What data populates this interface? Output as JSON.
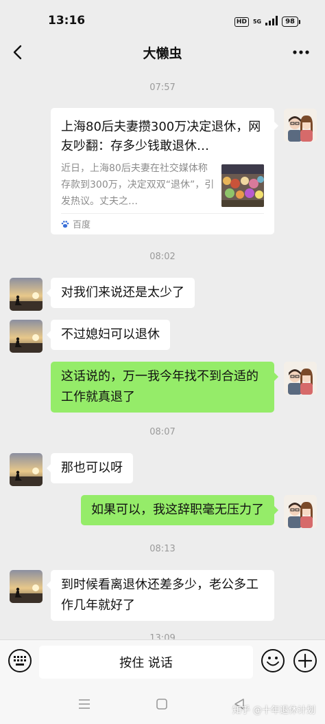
{
  "status_bar": {
    "time": "13:16",
    "hd_label": "HD",
    "network_label": "5G",
    "battery": "98"
  },
  "header": {
    "title": "大懒虫"
  },
  "timestamps": [
    "07:57",
    "08:02",
    "08:07",
    "08:13",
    "13:09"
  ],
  "link_card": {
    "title": "上海80后夫妻攒300万决定退休，网友吵翻：存多少钱敢退休…",
    "description": "近日，上海80后夫妻在社交媒体称存款到300万，决定双双“退休”，引发热议。丈夫之…",
    "source": "百度"
  },
  "messages": [
    {
      "from": "other",
      "text": "对我们来说还是太少了"
    },
    {
      "from": "other",
      "text": "不过媳妇可以退休"
    },
    {
      "from": "me",
      "text": "这话说的，万一我今年找不到合适的工作就真退了"
    },
    {
      "from": "other",
      "text": "那也可以呀"
    },
    {
      "from": "me",
      "text": "如果可以，我这辞职毫无压力了"
    },
    {
      "from": "other",
      "text": "到时候看离退休还差多少，老公多工作几年就好了"
    }
  ],
  "input_bar": {
    "hold_to_talk_label": "按住 说话"
  },
  "watermark": {
    "text": "知乎 @十年退休计划"
  },
  "icons": {
    "back": "chevron-left-icon",
    "more": "more-dots-icon",
    "keyboard": "keyboard-icon",
    "emoji": "emoji-icon",
    "plus": "plus-icon",
    "source": "baidu-paw-icon"
  },
  "colors": {
    "background": "#ededed",
    "incoming_bubble": "#ffffff",
    "outgoing_bubble": "#95ec69",
    "timestamp": "#9a9a9a"
  }
}
